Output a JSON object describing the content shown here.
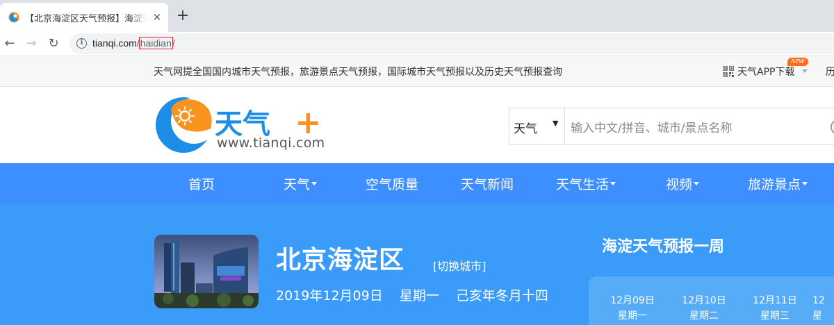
{
  "browser": {
    "tab_title": "【北京海淀区天气预报】海淀天气预报",
    "tab_close": "✕",
    "new_tab": "+",
    "back": "←",
    "forward": "→",
    "reload": "↻",
    "url_host": "tianqi.com",
    "url_sep1": "/",
    "url_path": "haidian",
    "url_sep2": "/"
  },
  "infobar": {
    "text": "天气网提全国国内城市天气预报，旅游景点天气预报，国际城市天气预报以及历史天气预报查询",
    "app_link": "天气APP下载",
    "new_badge": "NEW",
    "cut_link": "历"
  },
  "logo": {
    "name": "天气",
    "plus": "+",
    "url": "www.tianqi.com"
  },
  "search": {
    "select_value": "天气",
    "select_arrow": "▼",
    "placeholder": "输入中文/拼音、城市/景点名称"
  },
  "nav": {
    "items": [
      {
        "label": "首页",
        "caret": false
      },
      {
        "label": "天气",
        "caret": true
      },
      {
        "label": "空气质量",
        "caret": false
      },
      {
        "label": "天气新闻",
        "caret": false
      },
      {
        "label": "天气生活",
        "caret": true
      },
      {
        "label": "视频",
        "caret": true
      },
      {
        "label": "旅游景点",
        "caret": true
      }
    ]
  },
  "hero": {
    "city": "北京海淀区",
    "switch_city": "[切换城市]",
    "date": "2019年12月09日",
    "weekday": "星期一",
    "lunar": "己亥年冬月十四",
    "week_title": "海淀天气预报一周",
    "days": [
      {
        "date": "12月09日",
        "weekday": "星期一"
      },
      {
        "date": "12月10日",
        "weekday": "星期二"
      },
      {
        "date": "12月11日",
        "weekday": "星期三"
      },
      {
        "date": "12",
        "weekday": "星"
      }
    ]
  },
  "colors": {
    "nav_blue": "#3d8fff",
    "hero_blue": "#3a9cf8",
    "logo_orange": "#f7931e",
    "logo_blue": "#1d8ee8",
    "url_highlight_border": "#e0202a"
  }
}
